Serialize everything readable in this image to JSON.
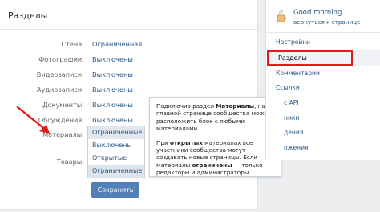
{
  "card": {
    "title": "Разделы",
    "rows": [
      {
        "label": "Стена:",
        "value": "Ограниченная"
      },
      {
        "label": "Фотографии:",
        "value": "Выключены"
      },
      {
        "label": "Видеозаписи:",
        "value": "Выключены"
      },
      {
        "label": "Аудиозаписи:",
        "value": "Выключены"
      },
      {
        "label": "Документы:",
        "value": "Выключены"
      },
      {
        "label": "Обсуждения:",
        "value": "Выключены"
      },
      {
        "label": "Материалы:",
        "value": ""
      },
      {
        "label": "Товары:",
        "value": ""
      }
    ],
    "dropdown": {
      "options": [
        "Ограниченные",
        "Выключены",
        "Открытые",
        "Ограниченные"
      ],
      "selected_index": 0,
      "hover_index": 3
    },
    "save_label": "Сохранить"
  },
  "tooltip": {
    "p1_before": "Подключив раздел ",
    "p1_bold": "Материалы",
    "p1_after": ", на главной странице сообщества можно расположить блок с любыми материалами.",
    "p2_before": "При ",
    "p2_bold1": "открытых",
    "p2_mid": " материалах все участники сообщества могут создавать новые страницы. Если материалы ",
    "p2_bold2": "ограничены",
    "p2_after": " — только редакторы и администраторы."
  },
  "right_panel": {
    "profile_name": "Good morning",
    "profile_sub": "вернуться к странице",
    "menu": [
      {
        "label": "Настройки",
        "active": false
      },
      {
        "label": "Разделы",
        "active": true
      },
      {
        "label": "Комментарии",
        "active": false
      },
      {
        "label": "Ссылки",
        "active": false
      },
      {
        "label": "с API",
        "active": false
      },
      {
        "label": "ники",
        "active": false
      },
      {
        "label": "дения",
        "active": false
      },
      {
        "label": "ожения",
        "active": false
      }
    ]
  },
  "colors": {
    "link": "#2a5885",
    "button": "#5181b8",
    "highlight": "#e01b1b",
    "background": "#edeef0"
  }
}
